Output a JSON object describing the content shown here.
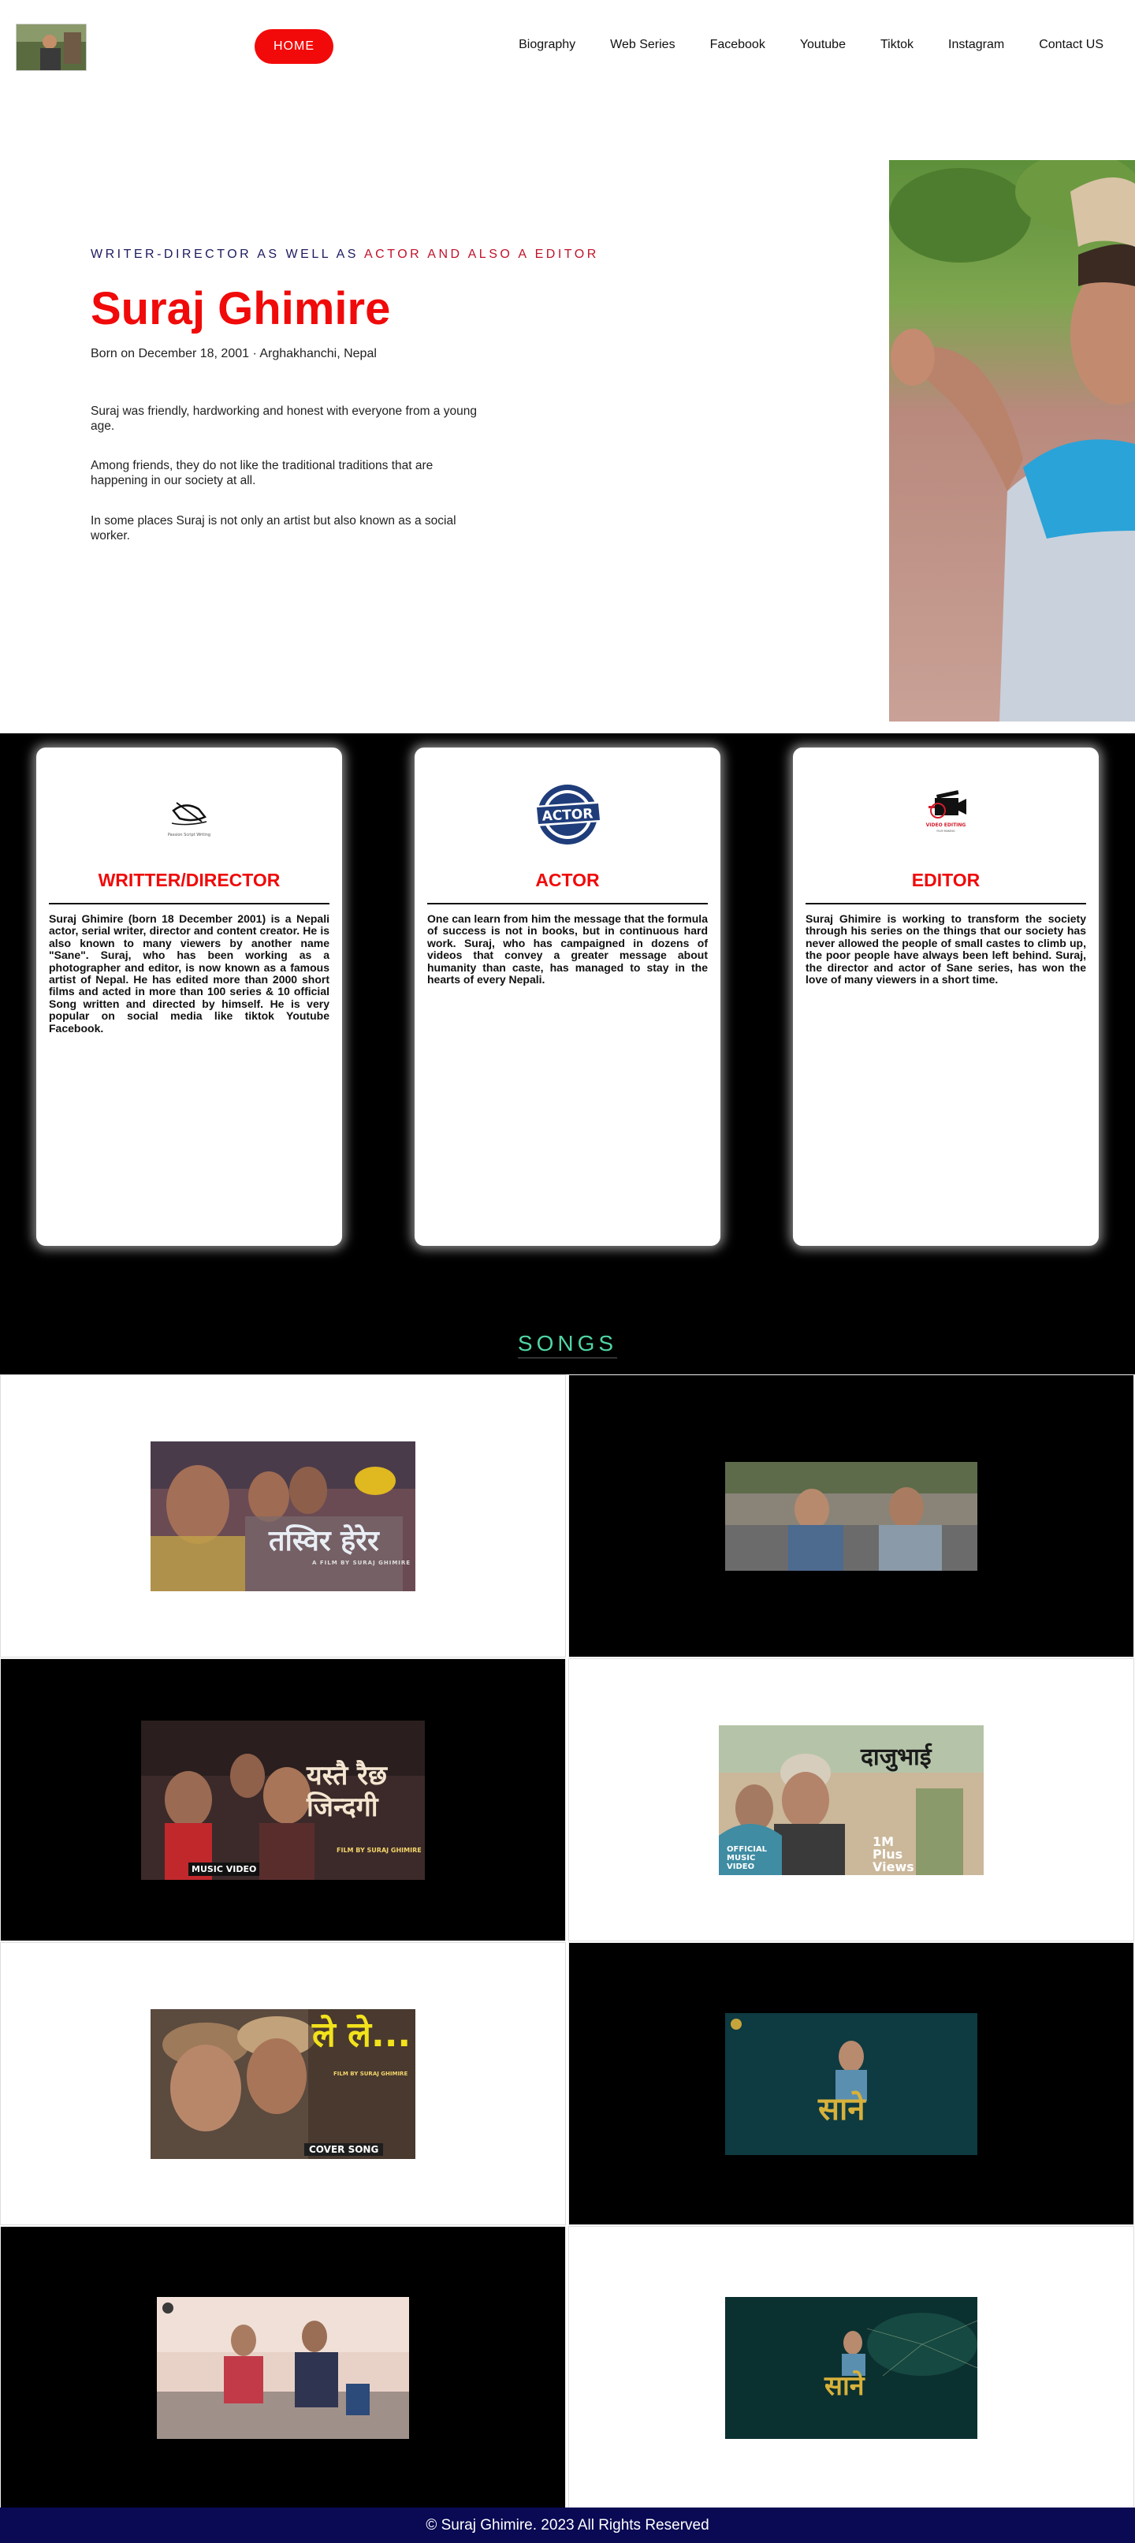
{
  "nav": {
    "home_label": "HOME",
    "links": [
      "Biography",
      "Web Series",
      "Facebook",
      "Youtube",
      "Tiktok",
      "Instagram",
      "Contact US"
    ]
  },
  "hero": {
    "tagline_part1": "WRITER-DIRECTOR AS WELL AS ",
    "tagline_part2": "ACTOR AND ALSO A EDITOR",
    "name": "Suraj Ghimire",
    "born": "Born on December 18, 2001 · Arghakhanchi, Nepal",
    "paragraphs": [
      "Suraj was friendly, hardworking and honest with everyone from a young age.",
      "Among friends, they do not like the traditional traditions that are happening in our society at all.",
      "In some places Suraj is not only an artist but also known as a social worker."
    ]
  },
  "cards": [
    {
      "title": "WRITTER/DIRECTOR",
      "icon": "writing-pen-icon",
      "icon_caption": "Passion Script Writing",
      "text": "Suraj Ghimire (born 18 December 2001) is a Nepali actor, serial writer, director and content creator. He is also known to many viewers by another name \"Sane\". Suraj, who has been working as a photographer and editor, is now known as a famous artist of Nepal. He has edited more than 2000 short films and acted in more than 100 series & 10 official Song written and directed by himself. He is very popular on social media like tiktok Youtube Facebook."
    },
    {
      "title": "ACTOR",
      "icon": "actor-badge-icon",
      "icon_caption": "ACTOR",
      "text": "One can learn from him the message that the formula of success is not in books, but in continuous hard work. Suraj, who has campaigned in dozens of videos that convey a greater message about humanity than caste, has managed to stay in the hearts of every Nepali."
    },
    {
      "title": "EDITOR",
      "icon": "video-editing-icon",
      "icon_caption": "VIDEO EDITING",
      "text": "Suraj Ghimire is working to transform the society through his series on the things that our society has never allowed the people of small castes to climb up, the poor people have always been left behind. Suraj, the director and actor of Sane series, has won the love of many viewers in a short time."
    }
  ],
  "songs_heading": "SONGS",
  "songs": [
    {
      "title": "तस्विर हेरेर",
      "subtitle": "A FILM BY SURAJ GHIMIRE"
    },
    {
      "title": "",
      "subtitle": ""
    },
    {
      "title": "यस्तै रैछ जिन्दगी",
      "subtitle": "FILM BY SURAJ GHIMIRE",
      "badge": "MUSIC VIDEO"
    },
    {
      "title": "दाजुभाई",
      "subtitle": "OFFICIAL MUSIC VIDEO",
      "badge": "1M Plus Views"
    },
    {
      "title": "ले ले...",
      "subtitle": "FILM BY SURAJ GHIMIRE",
      "badge": "COVER SONG"
    },
    {
      "title": "सानेे",
      "subtitle": ""
    },
    {
      "title": "",
      "subtitle": ""
    },
    {
      "title": "साने",
      "subtitle": ""
    }
  ],
  "footer": "© Suraj Ghimire. 2023 All Rights Reserved",
  "colors": {
    "accent_red": "#f00a0a",
    "navy": "#090954",
    "songs_green": "#4fd6a4"
  }
}
